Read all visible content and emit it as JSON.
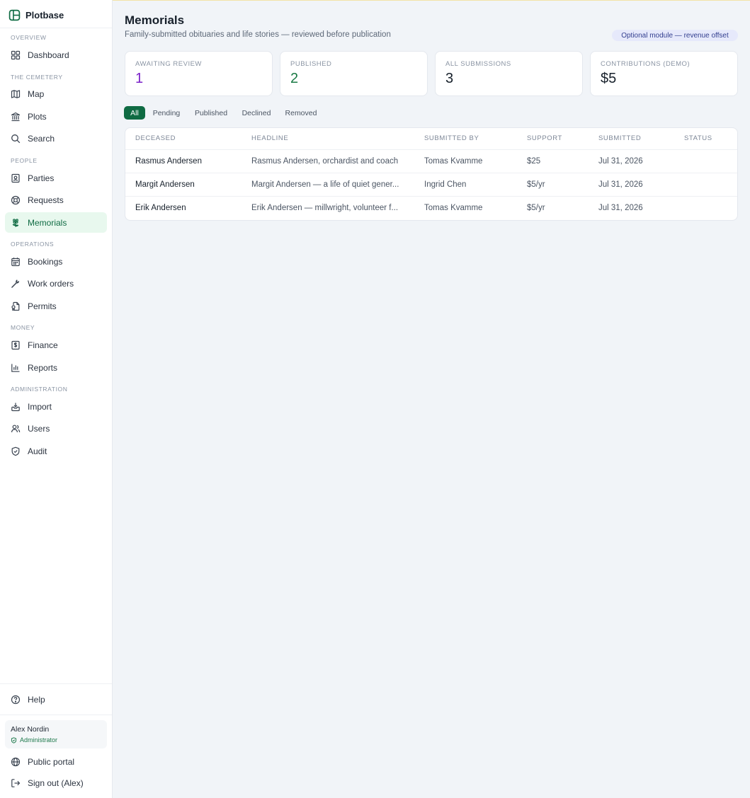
{
  "app": {
    "name": "Plotbase"
  },
  "sidebar": {
    "sections": {
      "overview": "OVERVIEW",
      "cemetery": "THE CEMETERY",
      "people": "PEOPLE",
      "operations": "OPERATIONS",
      "money": "MONEY",
      "administration": "ADMINISTRATION"
    },
    "items": {
      "dashboard": "Dashboard",
      "map": "Map",
      "plots": "Plots",
      "search": "Search",
      "parties": "Parties",
      "requests": "Requests",
      "memorials": "Memorials",
      "bookings": "Bookings",
      "work_orders": "Work orders",
      "permits": "Permits",
      "finance": "Finance",
      "reports": "Reports",
      "import": "Import",
      "users": "Users",
      "audit": "Audit"
    },
    "active_item": "memorials",
    "help": "Help",
    "user": {
      "name": "Alex Nordin",
      "role": "Administrator"
    },
    "public_portal": "Public portal",
    "sign_out": "Sign out (Alex)"
  },
  "header": {
    "title": "Memorials",
    "subtitle": "Family-submitted obituaries and life stories — reviewed before publication",
    "badge": "Optional module — revenue offset"
  },
  "stats": [
    {
      "label": "AWAITING REVIEW",
      "value": "1",
      "color": "#7b22c9"
    },
    {
      "label": "PUBLISHED",
      "value": "2",
      "color": "#1a7a45"
    },
    {
      "label": "ALL SUBMISSIONS",
      "value": "3",
      "color": "#17202b"
    },
    {
      "label": "CONTRIBUTIONS (DEMO)",
      "value": "$5",
      "color": "#17202b"
    }
  ],
  "filters": {
    "all": "All",
    "pending": "Pending",
    "published": "Published",
    "declined": "Declined",
    "removed": "Removed",
    "active": "all"
  },
  "table": {
    "columns": [
      "DECEASED",
      "HEADLINE",
      "SUBMITTED BY",
      "SUPPORT",
      "SUBMITTED",
      "STATUS"
    ],
    "rows": [
      {
        "deceased": "Rasmus Andersen",
        "headline": "Rasmus Andersen, orchardist and coach",
        "submitted_by": "Tomas Kvamme",
        "support": "$25",
        "submitted": "Jul 31, 2026",
        "status": ""
      },
      {
        "deceased": "Margit Andersen",
        "headline": "Margit Andersen — a life of quiet gener...",
        "submitted_by": "Ingrid Chen",
        "support": "$5/yr",
        "submitted": "Jul 31, 2026",
        "status": ""
      },
      {
        "deceased": "Erik Andersen",
        "headline": "Erik Andersen — millwright, volunteer f...",
        "submitted_by": "Tomas Kvamme",
        "support": "$5/yr",
        "submitted": "Jul 31, 2026",
        "status": ""
      }
    ]
  },
  "colors": {
    "brand": "#0f6b43",
    "active_nav_bg": "#e8f8ee",
    "badge_bg": "#e6e9fb"
  }
}
